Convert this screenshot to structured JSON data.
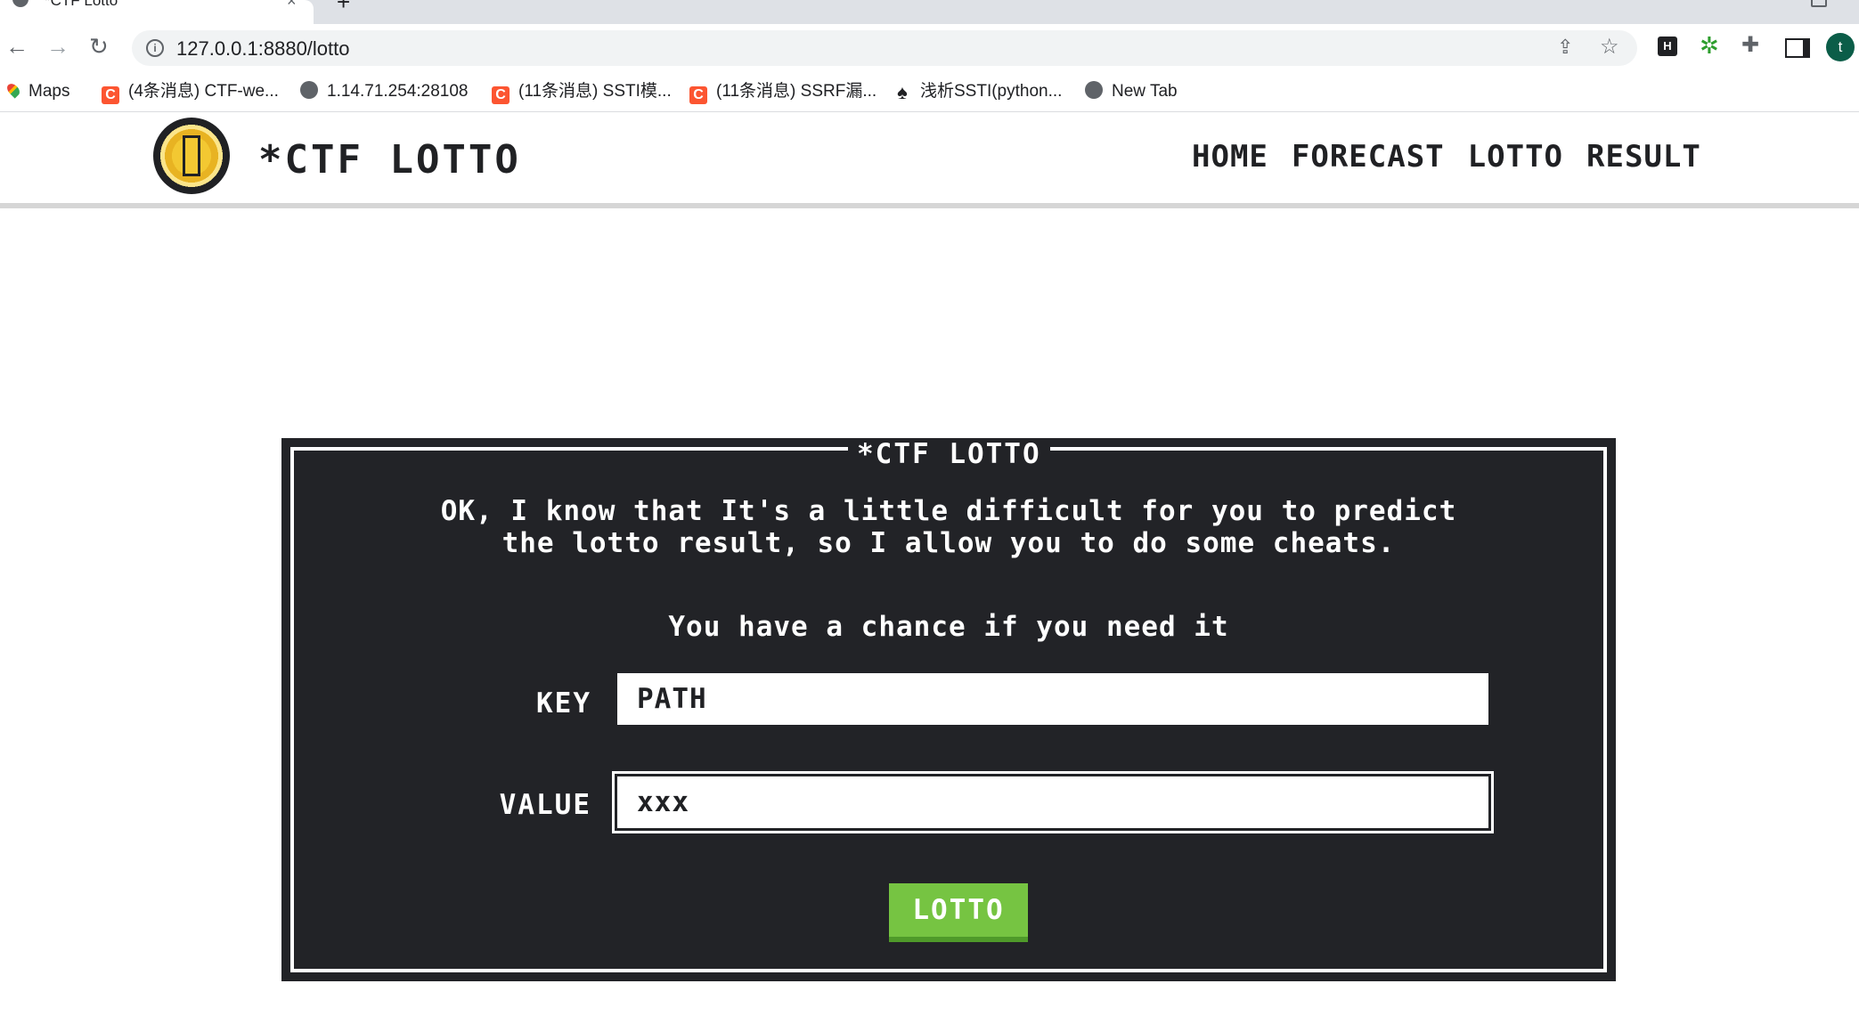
{
  "browser": {
    "tab_title": "*CTF Lotto",
    "tab_close": "×",
    "new_tab": "+",
    "url": "127.0.0.1:8880/lotto",
    "avatar_letter": "t",
    "ext_h_label": "H",
    "icons": [
      "back-icon",
      "forward-icon",
      "reload-icon",
      "info-icon",
      "share-icon",
      "star-icon",
      "gear-extension-icon",
      "puzzle-icon",
      "side-panel-icon"
    ]
  },
  "bookmarks": [
    {
      "label": "Maps",
      "icon": "maps-pin-icon"
    },
    {
      "label": "(4条消息) CTF-we...",
      "icon": "csdn-icon"
    },
    {
      "label": "1.14.71.254:28108",
      "icon": "globe-icon"
    },
    {
      "label": "(11条消息) SSTI模...",
      "icon": "csdn-icon"
    },
    {
      "label": "(11条消息) SSRF漏...",
      "icon": "csdn-icon"
    },
    {
      "label": "浅析SSTI(python...",
      "icon": "spade-icon"
    },
    {
      "label": "New Tab",
      "icon": "globe-icon"
    }
  ],
  "site": {
    "title": "*CTF LOTTO",
    "nav": [
      "HOME",
      "FORECAST",
      "LOTTO",
      "RESULT"
    ]
  },
  "panel": {
    "legend": "*CTF LOTTO",
    "intro_line1": "OK, I know that It's a little difficult for you to predict",
    "intro_line2": "the lotto result, so I allow you to do some cheats.",
    "chance": "You have a chance if you need it",
    "key_label": "KEY",
    "key_value": "PATH",
    "value_label": "VALUE",
    "value_value": "xxx",
    "button": "LOTTO"
  },
  "colors": {
    "panel_bg": "#222327",
    "button_green": "#76c442",
    "coin_yellow": "#f3c832"
  }
}
